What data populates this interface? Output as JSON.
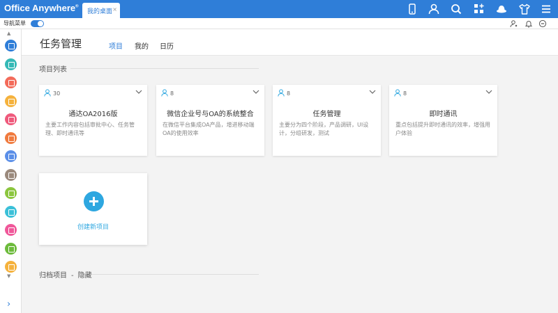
{
  "brand": {
    "name": "Office Anywhere",
    "mark": "®"
  },
  "tab": {
    "label": "我的桌面",
    "close": "×"
  },
  "topbar_icons": [
    "mobile-icon",
    "user-icon",
    "search-icon",
    "apps-add-icon",
    "hat-icon",
    "tshirt-icon",
    "menu-icon"
  ],
  "subbar": {
    "nav_label": "导航菜单",
    "nav_enabled": true
  },
  "sidebar": {
    "apps": [
      {
        "name": "app-workflow-icon",
        "color": "#2f7ed8"
      },
      {
        "name": "app-contacts-icon",
        "color": "#35b9b6"
      },
      {
        "name": "app-document-icon",
        "color": "#f36b5a"
      },
      {
        "name": "app-mail-icon",
        "color": "#f5b23d"
      },
      {
        "name": "app-book-icon",
        "color": "#ef5a7c"
      },
      {
        "name": "app-file-icon",
        "color": "#f07b3f"
      },
      {
        "name": "app-note-icon",
        "color": "#5b8fe8"
      },
      {
        "name": "app-hr-icon",
        "color": "#9b8a7d"
      },
      {
        "name": "app-calendar-icon",
        "color": "#8cc63f"
      },
      {
        "name": "app-message-icon",
        "color": "#3bc0d8"
      },
      {
        "name": "app-task-icon",
        "color": "#f0589a"
      },
      {
        "name": "app-report-icon",
        "color": "#6dbb3c"
      },
      {
        "name": "app-card-icon",
        "color": "#f5b23d"
      }
    ]
  },
  "page": {
    "title": "任务管理",
    "tabs": [
      {
        "label": "项目",
        "active": true
      },
      {
        "label": "我的",
        "active": false
      },
      {
        "label": "日历",
        "active": false
      }
    ]
  },
  "projects_section": {
    "title": "项目列表",
    "cards": [
      {
        "count": "30",
        "title": "通达OA2016版",
        "desc": "主要工作内容包括审批中心、任务管理、即时通讯等"
      },
      {
        "count": "8",
        "title": "微信企业号与OA的系统整合",
        "desc": "在微信平台集成OA产品，增进移动端OA的使用效率"
      },
      {
        "count": "8",
        "title": "任务管理",
        "desc": "主要分为四个阶段，产品调研，UI设计，分组研发，测试"
      },
      {
        "count": "8",
        "title": "即时通讯",
        "desc": "重点包括提升即时通讯的效率，增强用户体验"
      }
    ],
    "create_label": "创建新项目"
  },
  "archive": {
    "label": "归档项目",
    "sep": "-",
    "action": "隐藏"
  },
  "colors": {
    "primary": "#2f7ed8",
    "accent": "#2ea7e0"
  }
}
